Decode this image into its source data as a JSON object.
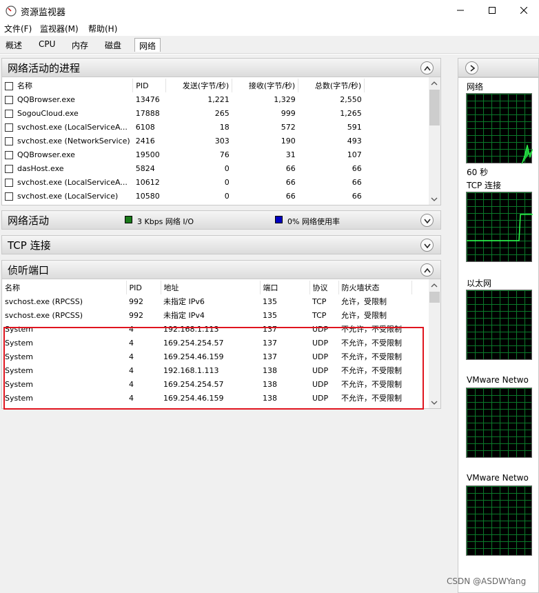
{
  "window": {
    "title": "资源监视器"
  },
  "menu": [
    "文件(F)",
    "监视器(M)",
    "帮助(H)"
  ],
  "tabs": [
    "概述",
    "CPU",
    "内存",
    "磁盘",
    "网络"
  ],
  "processes": {
    "title": "网络活动的进程",
    "columns": [
      "名称",
      "PID",
      "发送(字节/秒)",
      "接收(字节/秒)",
      "总数(字节/秒)"
    ],
    "rows": [
      [
        "QQBrowser.exe",
        "13476",
        "1,221",
        "1,329",
        "2,550"
      ],
      [
        "SogouCloud.exe",
        "17888",
        "265",
        "999",
        "1,265"
      ],
      [
        "svchost.exe (LocalServiceA...",
        "6108",
        "18",
        "572",
        "591"
      ],
      [
        "svchost.exe (NetworkService)",
        "2416",
        "303",
        "190",
        "493"
      ],
      [
        "QQBrowser.exe",
        "19500",
        "76",
        "31",
        "107"
      ],
      [
        "dasHost.exe",
        "5824",
        "0",
        "66",
        "66"
      ],
      [
        "svchost.exe (LocalServiceA...",
        "10612",
        "0",
        "66",
        "66"
      ],
      [
        "svchost.exe (LocalService)",
        "10580",
        "0",
        "66",
        "66"
      ]
    ]
  },
  "network_activity": {
    "title": "网络活动",
    "io": "3 Kbps 网络 I/O",
    "usage": "0% 网络使用率"
  },
  "tcp": {
    "title": "TCP 连接"
  },
  "listening": {
    "title": "侦听端口",
    "columns": [
      "名称",
      "PID",
      "地址",
      "端口",
      "协议",
      "防火墙状态"
    ],
    "rows": [
      [
        "svchost.exe (RPCSS)",
        "992",
        "未指定 IPv6",
        "135",
        "TCP",
        "允许，受限制"
      ],
      [
        "svchost.exe (RPCSS)",
        "992",
        "未指定 IPv4",
        "135",
        "TCP",
        "允许，受限制"
      ],
      [
        "System",
        "4",
        "192.168.1.113",
        "137",
        "UDP",
        "不允许，不受限制"
      ],
      [
        "System",
        "4",
        "169.254.254.57",
        "137",
        "UDP",
        "不允许，不受限制"
      ],
      [
        "System",
        "4",
        "169.254.46.159",
        "137",
        "UDP",
        "不允许，不受限制"
      ],
      [
        "System",
        "4",
        "192.168.1.113",
        "138",
        "UDP",
        "不允许，不受限制"
      ],
      [
        "System",
        "4",
        "169.254.254.57",
        "138",
        "UDP",
        "不允许，不受限制"
      ],
      [
        "System",
        "4",
        "169.254.46.159",
        "138",
        "UDP",
        "不允许，不受限制"
      ]
    ]
  },
  "graphs": {
    "network": "网络",
    "time": "60 秒",
    "tcp": "TCP 连接",
    "ethernet": "以太网",
    "vmware1": "VMware Netwo",
    "vmware2": "VMware Netwo"
  },
  "watermark": "CSDN @ASDWYang",
  "colors": {
    "highlight": "#e0141e",
    "io_legend": "#1a7a1a",
    "usage_legend": "#0000c0"
  }
}
